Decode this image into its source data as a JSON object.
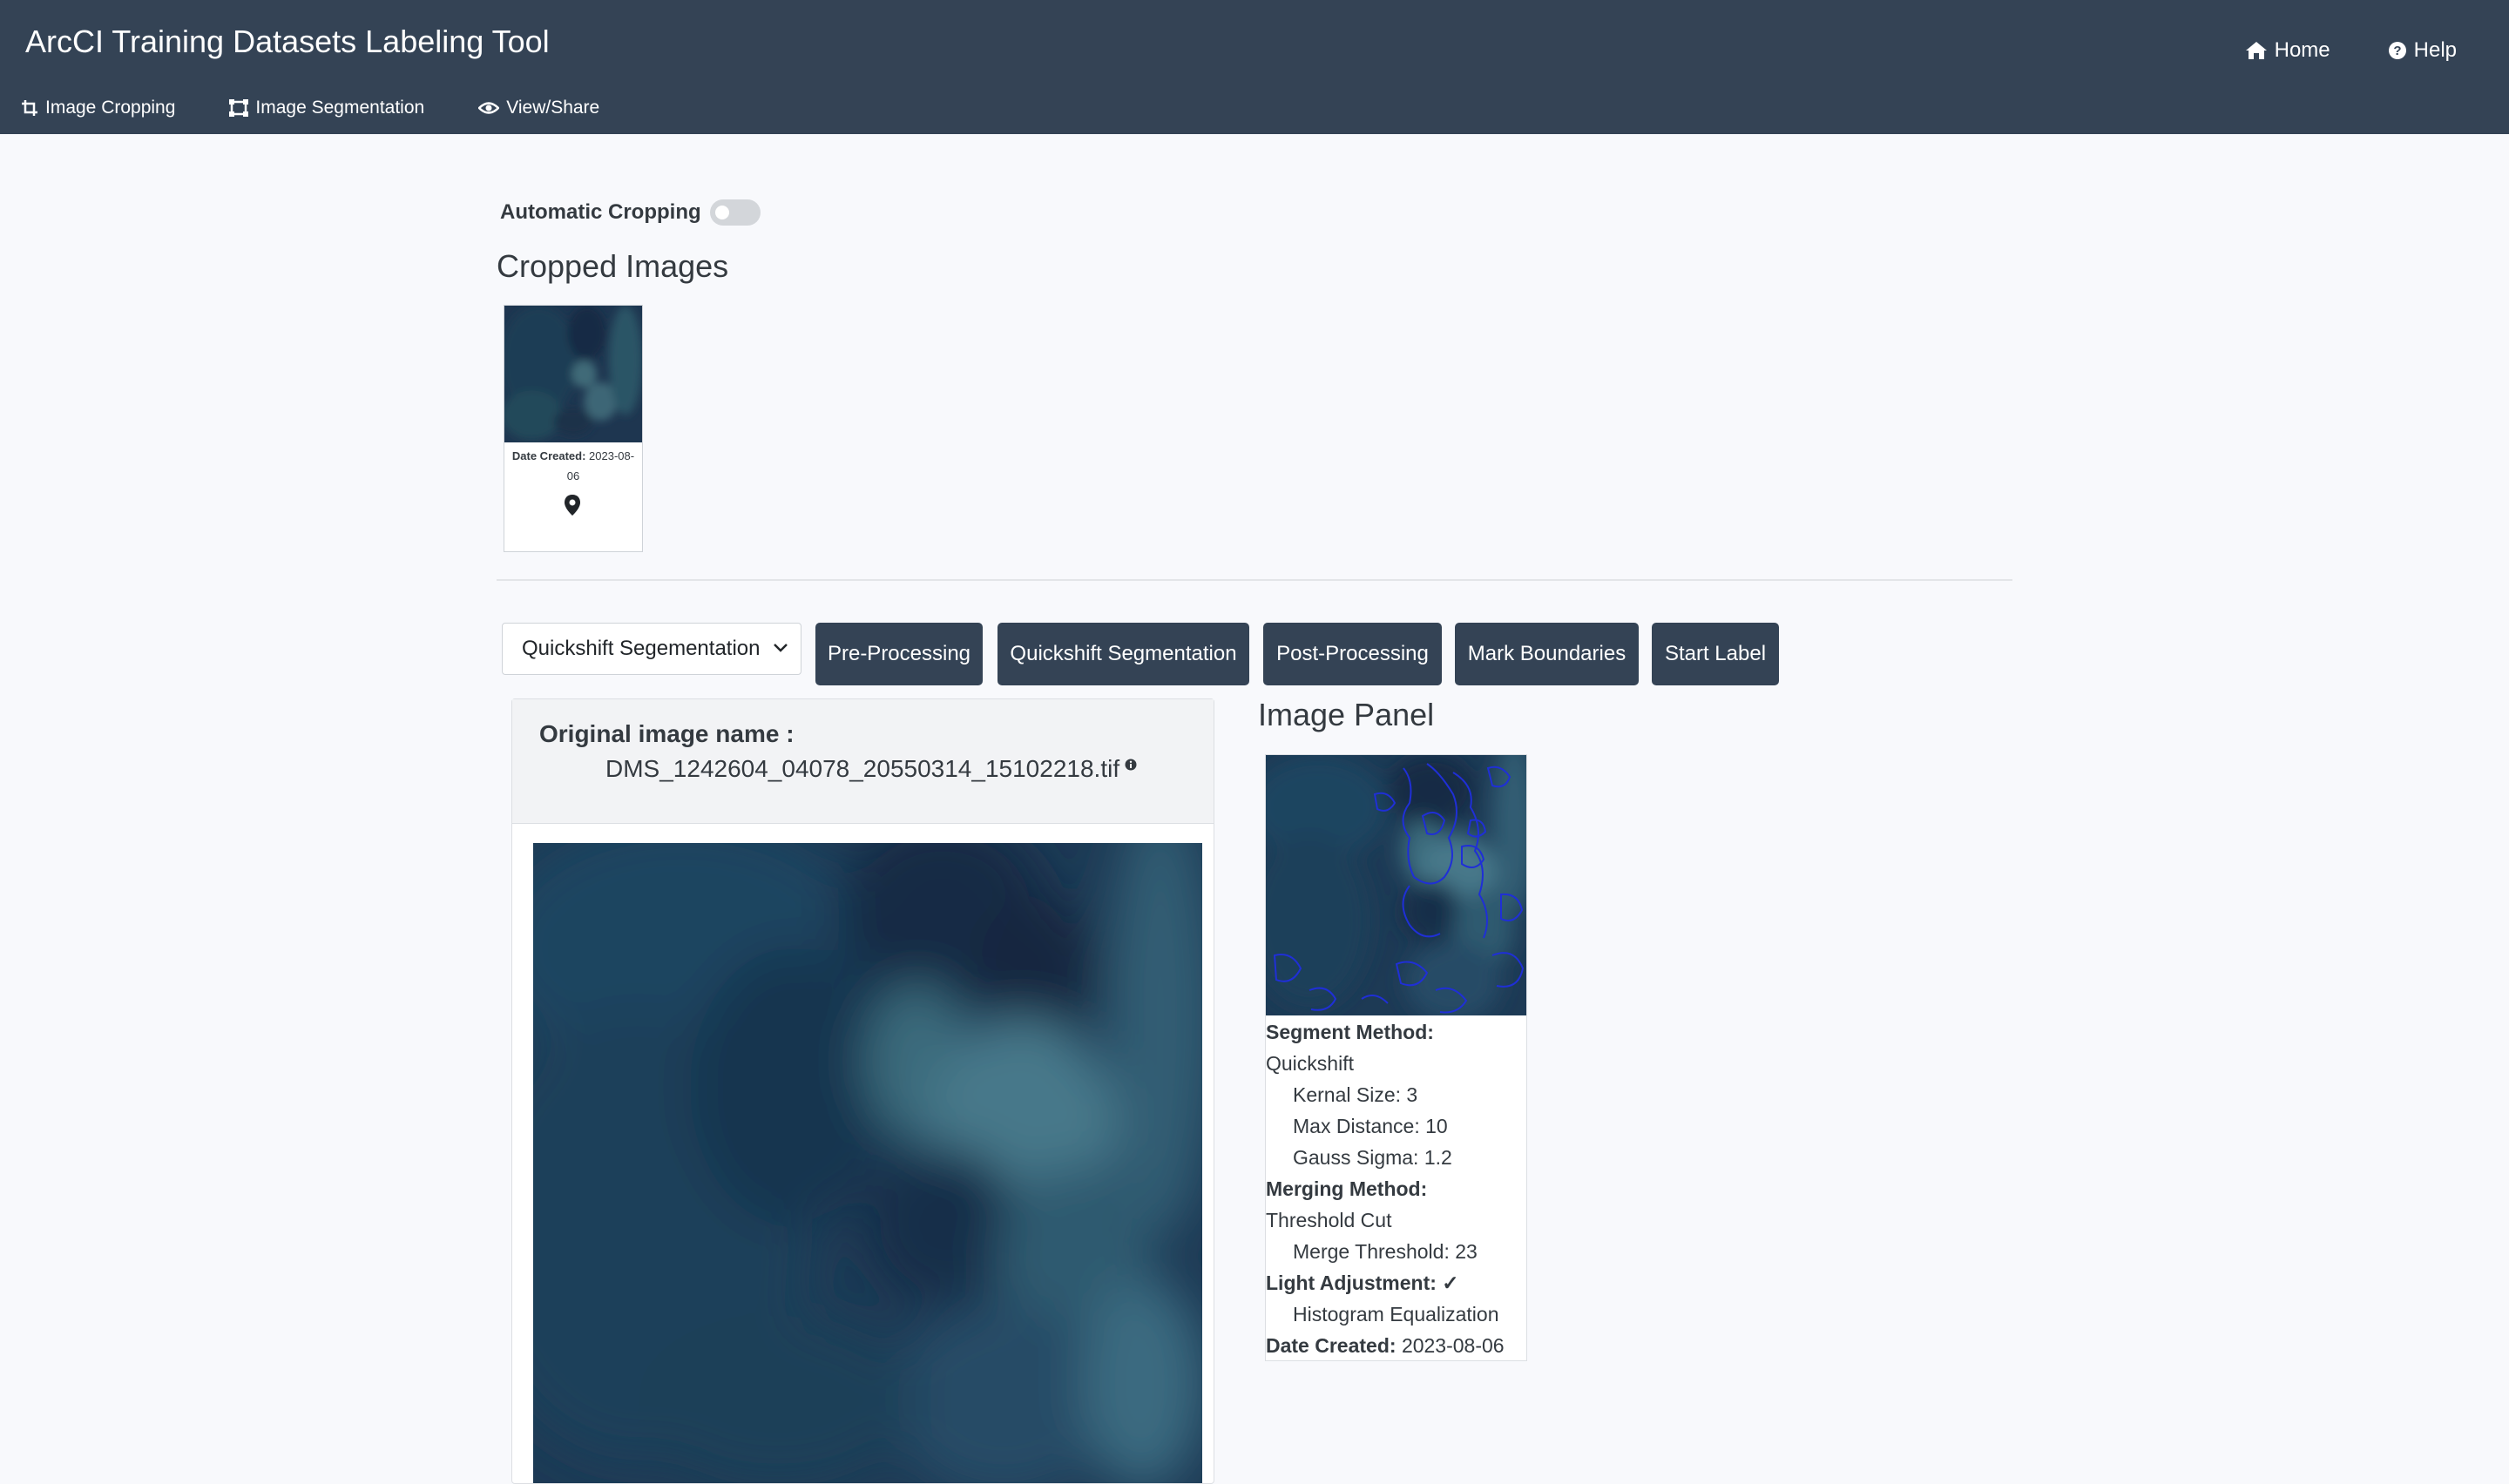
{
  "navbar": {
    "brand": "ArcCI Training Datasets Labeling Tool",
    "right_links": [
      {
        "label": "Home",
        "icon": "home-icon"
      },
      {
        "label": "Help",
        "icon": "question-circle-icon"
      }
    ],
    "sub_links": [
      {
        "label": "Image Cropping",
        "icon": "crop-icon"
      },
      {
        "label": "Image Segmentation",
        "icon": "segmentation-icon"
      },
      {
        "label": "View/Share",
        "icon": "eye-icon"
      }
    ],
    "background": "#344355"
  },
  "auto_cropping": {
    "label": "Automatic Cropping",
    "enabled": false
  },
  "cropped_images": {
    "title": "Cropped Images",
    "items": [
      {
        "date_label": "Date Created:",
        "date_value": "2023-08-06",
        "icon": "map-pin-icon"
      }
    ]
  },
  "toolbar": {
    "select_value": "Quickshift Segementation",
    "buttons": [
      "Pre-Processing",
      "Quickshift Segmentation",
      "Post-Processing",
      "Mark Boundaries",
      "Start Label"
    ],
    "button_color": "#344355"
  },
  "original": {
    "label": "Original image name :",
    "name": "DMS_1242604_04078_20550314_15102218.tif",
    "info_icon": "info-circle-icon"
  },
  "image_panel": {
    "title": "Image Panel",
    "segment_method_label": "Segment Method:",
    "segment_method": "Quickshift",
    "kernel_size": "Kernal Size: 3",
    "max_distance": "Max Distance: 10",
    "gauss_sigma": "Gauss Sigma: 1.2",
    "merging_method_label": "Merging Method:",
    "merging_method": "Threshold Cut",
    "merge_threshold": "Merge Threshold: 23",
    "light_adjustment_label": "Light Adjustment: ✓",
    "light_adjustment": "Histogram Equalization",
    "date_created_label": "Date Created:",
    "date_created": "2023-08-06",
    "boundary_color": "#1f2fd6"
  }
}
